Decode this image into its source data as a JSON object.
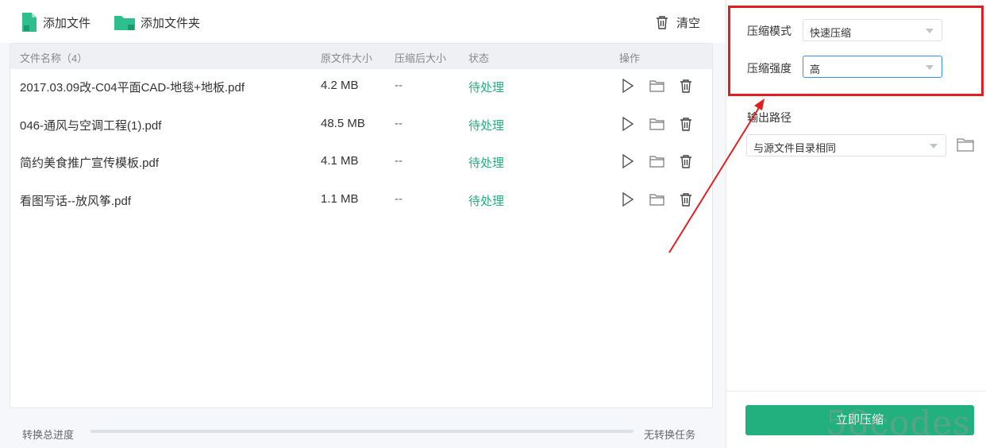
{
  "toolbar": {
    "add_file_label": "添加文件",
    "add_folder_label": "添加文件夹",
    "clear_label": "清空"
  },
  "table": {
    "headers": {
      "name": "文件名称（4）",
      "size": "原文件大小",
      "compressed_size": "压缩后大小",
      "status": "状态",
      "operation": "操作"
    },
    "rows": [
      {
        "name": "2017.03.09改-C04平面CAD-地毯+地板.pdf",
        "size": "4.2 MB",
        "compressed": "--",
        "status": "待处理"
      },
      {
        "name": "046-通风与空调工程(1).pdf",
        "size": "48.5 MB",
        "compressed": "--",
        "status": "待处理"
      },
      {
        "name": "简约美食推广宣传模板.pdf",
        "size": "4.1 MB",
        "compressed": "--",
        "status": "待处理"
      },
      {
        "name": "看图写话--放风筝.pdf",
        "size": "1.1 MB",
        "compressed": "--",
        "status": "待处理"
      }
    ]
  },
  "progress": {
    "label": "转换总进度",
    "status": "无转换任务",
    "fraction": 0
  },
  "settings": {
    "mode_label": "压缩模式",
    "mode_value": "快速压缩",
    "strength_label": "压缩强度",
    "strength_value": "高",
    "output_label": "输出路径",
    "output_value": "与源文件目录相同"
  },
  "action": {
    "compress_label": "立即压缩"
  },
  "watermark": "58codes",
  "colors": {
    "accent": "#21b07e",
    "highlight": "#e02020",
    "focus": "#3a8ee6"
  },
  "icons": [
    "add-file-icon",
    "add-folder-icon",
    "trash-icon",
    "play-icon",
    "folder-icon",
    "delete-icon",
    "caret-down-icon",
    "open-folder-icon"
  ]
}
